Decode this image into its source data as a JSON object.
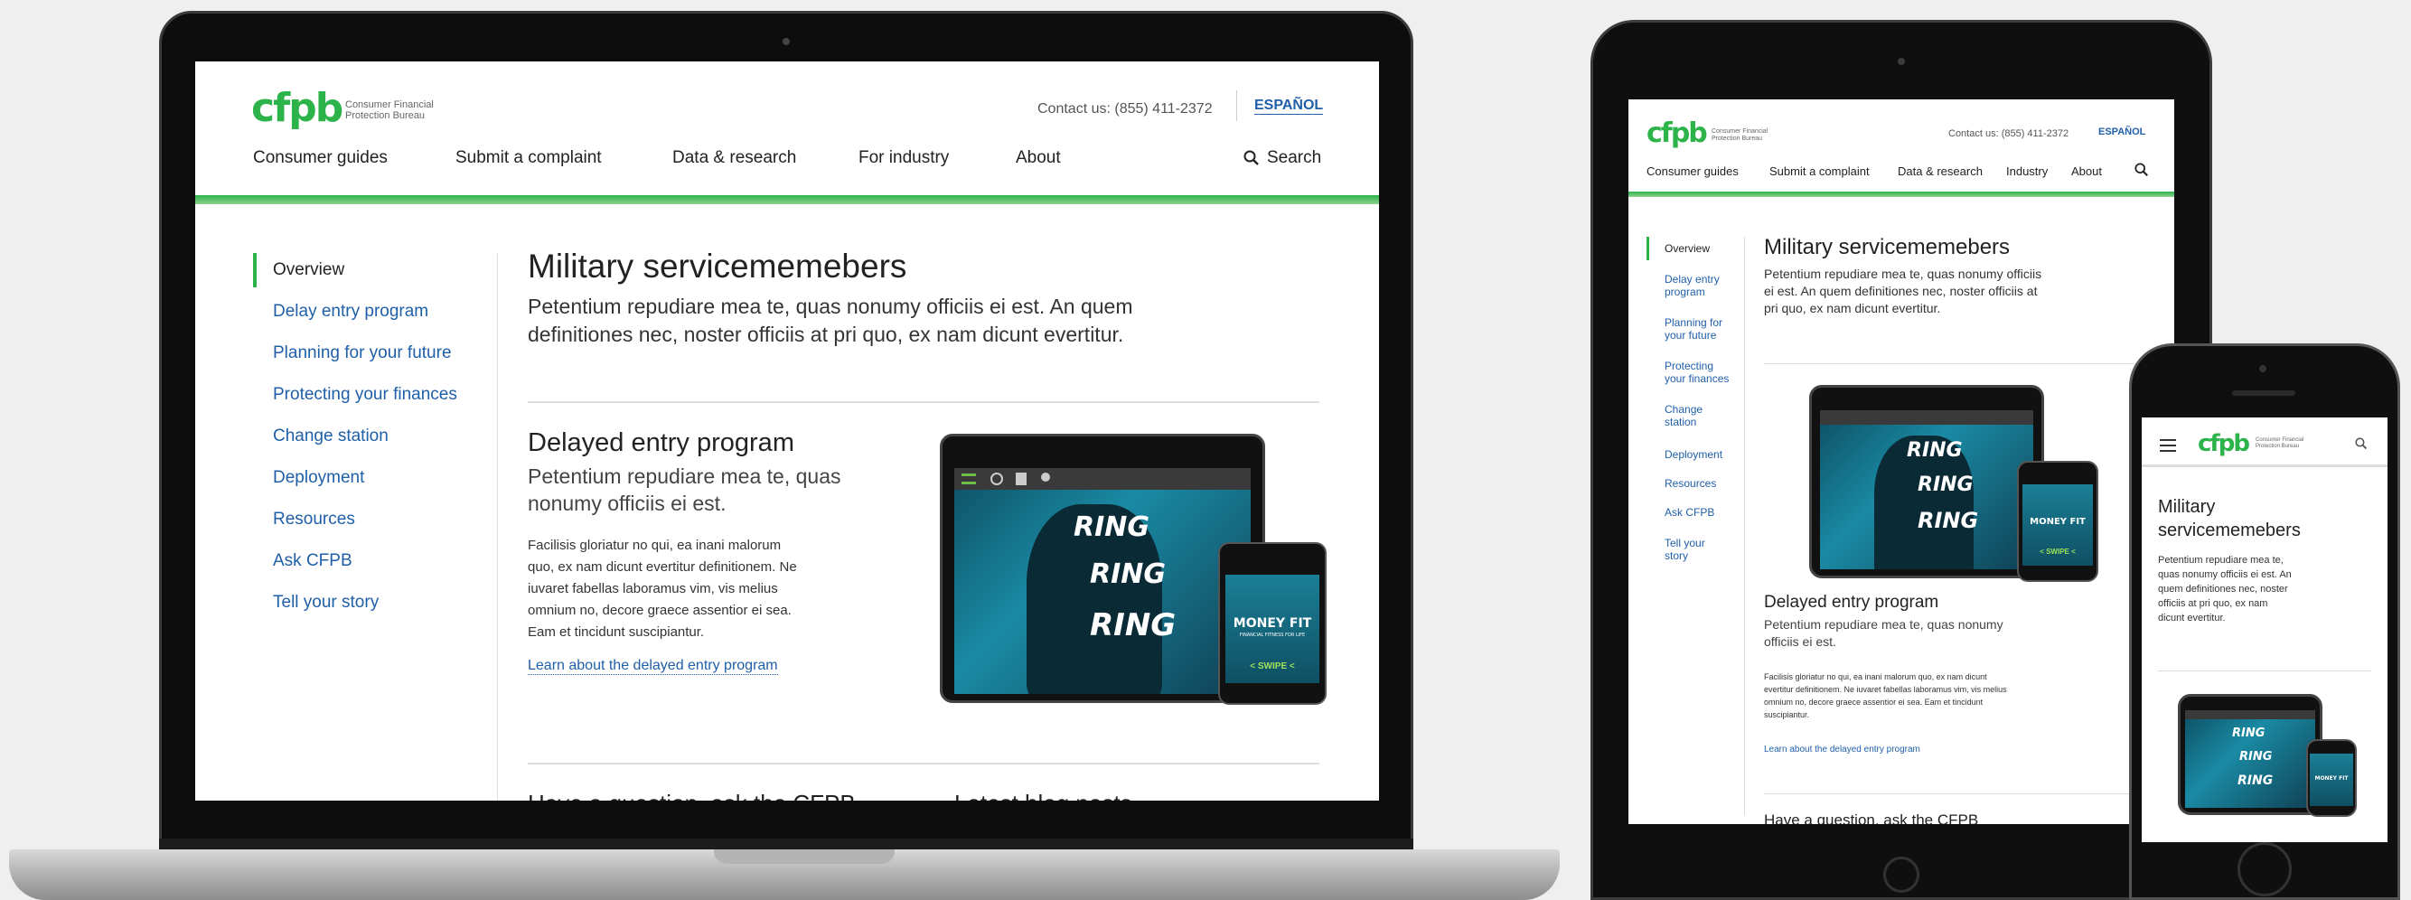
{
  "site": {
    "logo": "cfpb",
    "logo_sub_1": "Consumer Financial",
    "logo_sub_2": "Protection Bureau",
    "contact": "Contact us: (855) 411-2372",
    "contact_short": "Contact us: (855) 411-2372",
    "espanol": "ESPAÑOL"
  },
  "nav": {
    "consumer_guides": "Consumer guides",
    "submit_complaint": "Submit a complaint",
    "data_research": "Data & research",
    "for_industry": "For industry",
    "industry": "Industry",
    "about": "About",
    "search": "Search"
  },
  "sidenav": {
    "overview": "Overview",
    "delay_entry": "Delay entry program",
    "delay_entry_1": "Delay entry",
    "delay_entry_2": "program",
    "planning": "Planning for your future",
    "planning_1": "Planning for",
    "planning_2": "your future",
    "protecting": "Protecting your finances",
    "protecting_1": "Protecting",
    "protecting_2": "your finances",
    "change_station": "Change station",
    "change_1": "Change",
    "change_2": "station",
    "deployment": "Deployment",
    "resources": "Resources",
    "ask_cfpb": "Ask CFPB",
    "tell_story": "Tell your story",
    "tell_1": "Tell your",
    "tell_2": "story"
  },
  "main": {
    "title": "Military servicememebers",
    "phone_title_1": "Military",
    "phone_title_2": "servicememebers",
    "intro_1": "Petentium repudiare mea te, quas nonumy officiis ei est. An quem",
    "intro_2": "definitiones nec, noster officiis at pri quo, ex nam dicunt evertitur.",
    "tab_intro_1": "Petentium repudiare mea te, quas nonumy officiis",
    "tab_intro_2": "ei est. An quem definitiones nec, noster officiis at",
    "tab_intro_3": "pri quo, ex nam dicunt evertitur.",
    "ph_intro_1": "Petentium repudiare mea te,",
    "ph_intro_2": "quas nonumy officiis ei est. An",
    "ph_intro_3": "quem definitiones nec, noster",
    "ph_intro_4": "officiis at pri quo, ex nam",
    "ph_intro_5": "dicunt evertitur.",
    "section_title": "Delayed entry program",
    "section_sub_1": "Petentium repudiare mea te, quas",
    "section_sub_2": "nonumy officiis ei est.",
    "tab_sub_1": "Petentium repudiare mea te, quas nonumy",
    "tab_sub_2": "officiis ei est.",
    "body_1": "Facilisis gloriatur no qui, ea inani malorum",
    "body_2": "quo, ex nam dicunt evertitur definitionem. Ne",
    "body_3": "iuvaret fabellas laboramus vim, vis melius",
    "body_4": "omnium no, decore graece assentior ei sea.",
    "body_5": "Eam et tincidunt suscipiantur.",
    "tab_body_1": "Facilisis gloriatur no qui, ea inani malorum quo, ex nam dicunt",
    "tab_body_2": "evertitur definitionem. Ne iuvaret fabellas laboramus vim, vis melius",
    "tab_body_3": "omnium no, decore graece assentior ei sea. Eam et tincidunt",
    "tab_body_4": "suscipiantur.",
    "link": "Learn about the delayed entry program",
    "bottom_left": "Have a question, ask the CFPB",
    "bottom_right": "Latest blog posts"
  },
  "illustration": {
    "ring": "RING",
    "money_1": "MONEY FIT",
    "money_2": "FINANCIAL FITNESS FOR LIFE",
    "swipe": "< SWIPE <"
  },
  "colors": {
    "green": "#2cb34a",
    "link_blue": "#1f5fa8"
  }
}
